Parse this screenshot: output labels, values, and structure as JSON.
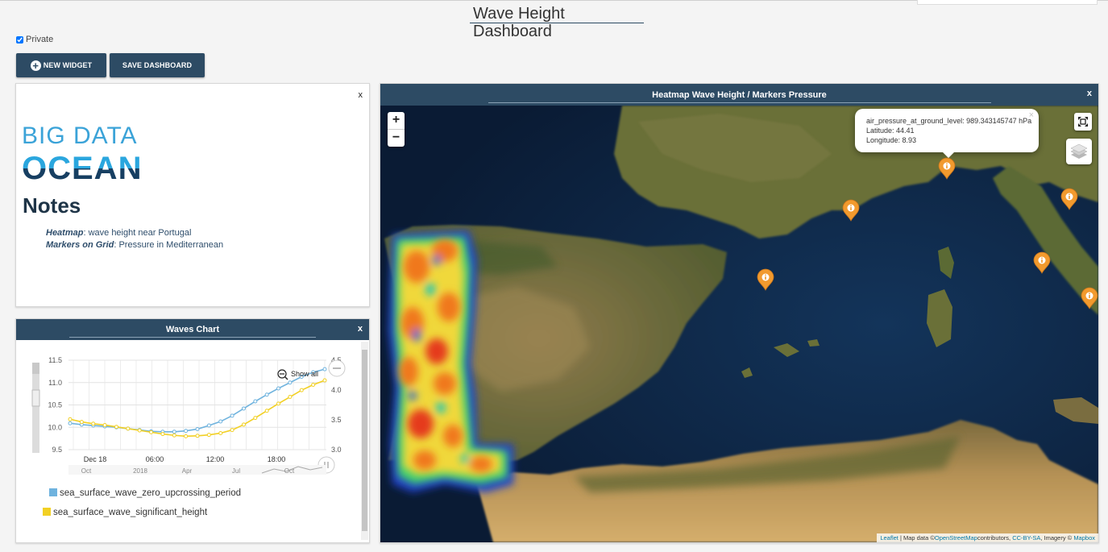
{
  "page": {
    "title": "Wave Height Dashboard"
  },
  "private": {
    "label": "Private",
    "checked": true
  },
  "toolbar": {
    "new_widget_label": "NEW WIDGET",
    "save_dashboard_label": "SAVE DASHBOARD"
  },
  "notes_widget": {
    "close_label": "x",
    "logo": {
      "line1": "BIG DATA",
      "line2": "OCEAN"
    },
    "title": "Notes",
    "lines": [
      {
        "term": "Heatmap",
        "text": ":  wave height near Portugal"
      },
      {
        "term": "Markers on Grid",
        "text": ": Pressure in Mediterranean"
      }
    ]
  },
  "chart_widget": {
    "title": "Waves Chart",
    "close_label": "x",
    "show_all_label": "Show all",
    "legend": [
      {
        "label": "sea_surface_wave_zero_upcrossing_period",
        "color": "#6fb3de"
      },
      {
        "label": "sea_surface_wave_significant_height",
        "color": "#f2d024"
      }
    ],
    "navigator_labels": [
      "Oct",
      "2018",
      "Apr",
      "Jul",
      "Oct"
    ]
  },
  "chart_data": {
    "type": "line",
    "x": [
      "Dec 18",
      "",
      "",
      "",
      "06:00",
      "",
      "",
      "",
      "12:00",
      "",
      "",
      "",
      "18:00",
      "",
      "",
      "",
      ""
    ],
    "x_tick_labels": [
      "Dec 18",
      "06:00",
      "12:00",
      "18:00"
    ],
    "y_left": {
      "ticks": [
        "11.5",
        "11.0",
        "10.5",
        "10.0",
        "9.5"
      ],
      "range": [
        9.5,
        11.5
      ]
    },
    "y_right": {
      "ticks": [
        "4.5",
        "4.0",
        "3.5",
        "3.0"
      ],
      "range": [
        3.0,
        4.5
      ]
    },
    "series": [
      {
        "name": "sea_surface_wave_zero_upcrossing_period",
        "color": "#6fb3de",
        "axis": "left",
        "values": [
          10.09,
          10.06,
          10.04,
          10.02,
          10.0,
          9.97,
          9.94,
          9.91,
          9.9,
          9.9,
          9.92,
          9.96,
          10.04,
          10.13,
          10.26,
          10.42,
          10.58,
          10.73,
          10.87,
          11.0,
          11.13,
          11.23,
          11.3
        ]
      },
      {
        "name": "sea_surface_wave_significant_height",
        "color": "#f2d024",
        "axis": "left",
        "values": [
          10.18,
          10.12,
          10.08,
          10.05,
          10.01,
          9.97,
          9.93,
          9.89,
          9.85,
          9.82,
          9.8,
          9.81,
          9.83,
          9.87,
          9.94,
          10.06,
          10.21,
          10.37,
          10.53,
          10.68,
          10.83,
          10.95,
          11.05
        ]
      }
    ]
  },
  "map_widget": {
    "title": "Heatmap Wave Height / Markers Pressure",
    "close_label": "x",
    "zoom_in": "+",
    "zoom_out": "−",
    "popup": {
      "close": "×",
      "pressure": "air_pressure_at_ground_level: 989.343145747 hPa",
      "latitude": "Latitude: 44.41",
      "longitude": "Longitude: 8.93"
    },
    "attribution": {
      "leaflet": "Leaflet",
      "sep1": " | Map data ©",
      "osm": "OpenStreetMap",
      "contrib": "contributors, ",
      "license": "CC-BY-SA",
      "imagery": ", Imagery © ",
      "mapbox": "Mapbox"
    },
    "marker_color": "#f29a2e",
    "heatmap_colors": [
      "#1a46c9",
      "#22c6b6",
      "#3ccf3c",
      "#e9e13a",
      "#f2781f",
      "#e53a1e"
    ]
  }
}
